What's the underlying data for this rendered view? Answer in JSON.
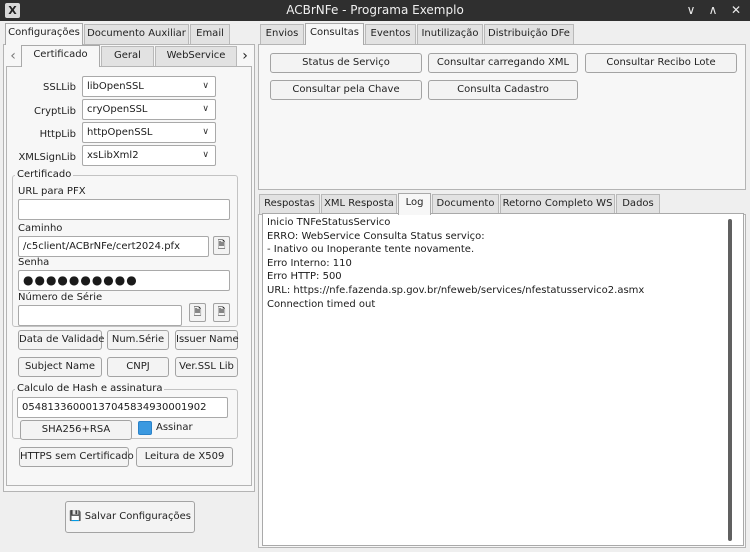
{
  "window": {
    "title": "ACBrNFe - Programa Exemplo",
    "minimize_glyph": "∨",
    "maximize_glyph": "∧",
    "close_glyph": "✕",
    "app_icon_glyph": "X"
  },
  "left_tabs": [
    "Configurações",
    "Documento Auxiliar",
    "Email"
  ],
  "left_sub_tabs": [
    "Certificado",
    "Geral",
    "WebService"
  ],
  "nav": {
    "prev": "‹",
    "next": "›"
  },
  "libs": [
    {
      "label": "SSLLib",
      "value": "libOpenSSL"
    },
    {
      "label": "CryptLib",
      "value": "cryOpenSSL"
    },
    {
      "label": "HttpLib",
      "value": "httpOpenSSL"
    },
    {
      "label": "XMLSignLib",
      "value": "xsLibXml2"
    }
  ],
  "chevron": "∨",
  "cert": {
    "group_title": "Certificado",
    "url_label": "URL para PFX",
    "url_value": "",
    "path_label": "Caminho",
    "path_value": "/c5client/ACBrNFe/cert2024.pfx",
    "password_label": "Senha",
    "password_value": "●●●●●●●●●●",
    "serial_label": "Número de Série",
    "serial_value": ""
  },
  "cert_buttons": [
    "Data de Validade",
    "Num.Série",
    "Issuer Name",
    "Subject Name",
    "CNPJ",
    "Ver.SSL Lib"
  ],
  "hash": {
    "group_title": "Calculo de Hash e assinatura",
    "value": "05481336000137045834930001902",
    "button": "SHA256+RSA",
    "checkbox_label": "Assinar"
  },
  "extra_buttons": [
    "HTTPS sem Certificado",
    "Leitura de X509"
  ],
  "save_button": "Salvar Configurações",
  "right_tabs": [
    "Envios",
    "Consultas",
    "Eventos",
    "Inutilização",
    "Distribuição DFe"
  ],
  "consultas_buttons": [
    "Status de Serviço",
    "Consultar carregando XML",
    "Consultar Recibo Lote",
    "Consultar pela Chave",
    "Consulta Cadastro"
  ],
  "output_tabs": [
    "Respostas",
    "XML Resposta",
    "Log",
    "Documento",
    "Retorno Completo WS",
    "Dados"
  ],
  "log_lines": [
    "Inicio TNFeStatusServico",
    "ERRO: WebService Consulta Status serviço:",
    "- Inativo ou Inoperante tente novamente.",
    "Erro Interno: 110",
    "Erro HTTP: 500",
    "URL: https://nfe.fazenda.sp.gov.br/nfeweb/services/nfestatusservico2.asmx",
    "Connection timed out"
  ],
  "icons": {
    "file": "🗎",
    "save": "💾"
  }
}
